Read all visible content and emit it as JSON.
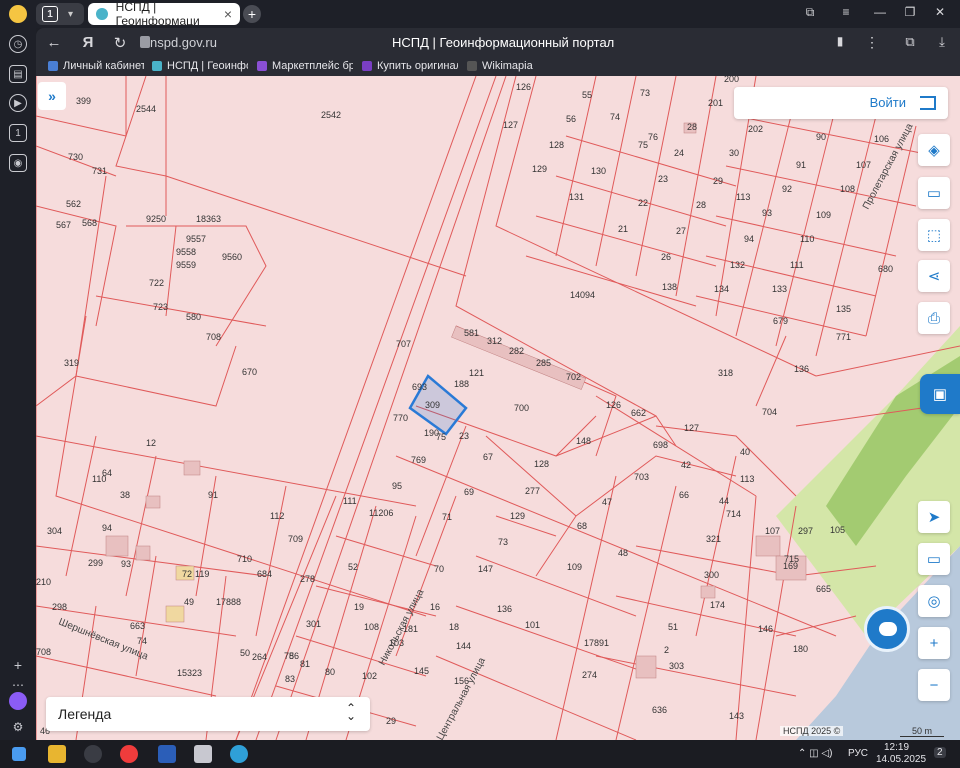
{
  "browser": {
    "tab_count": "1",
    "active_tab_title": "НСПД | Геоинформаци",
    "url_host": "nspd.gov.ru",
    "page_title": "НСПД | Геоинформационный портал",
    "bookmarks": [
      {
        "label": "Личный кабинет",
        "color": "#4a7fd4"
      },
      {
        "label": "НСПД | Геоинфор",
        "color": "#4ab3c9"
      },
      {
        "label": "Маркетплейс бре",
        "color": "#8a4fd4"
      },
      {
        "label": "Купить оригинал",
        "color": "#7a3fc4"
      },
      {
        "label": "Wikimapia",
        "color": "#555555"
      }
    ]
  },
  "map": {
    "login_label": "Войти",
    "legend_label": "Легенда",
    "copyright": "НСПД 2025 ©",
    "scale_label": "50 m",
    "streets": [
      "Пролетарская улица",
      "Никольская улица",
      "2-я Центральная улица",
      "Шершнёвская улица"
    ],
    "selected_plot": "126",
    "plot_labels": [
      "399",
      "2544",
      "2542",
      "126",
      "127",
      "55",
      "73",
      "200",
      "201",
      "28",
      "202",
      "90",
      "106",
      "730",
      "731",
      "128",
      "56",
      "74",
      "75",
      "76",
      "24",
      "30",
      "91",
      "107",
      "129",
      "130",
      "23",
      "29",
      "113",
      "92",
      "108",
      "562",
      "567",
      "568",
      "9250",
      "18363",
      "131",
      "22",
      "28",
      "93",
      "109",
      "9557",
      "9558",
      "9559",
      "9560",
      "21",
      "27",
      "94",
      "110",
      "26",
      "132",
      "111",
      "722",
      "14094",
      "138",
      "134",
      "133",
      "680",
      "723",
      "580",
      "135",
      "708",
      "581",
      "312",
      "282",
      "285",
      "679",
      "771",
      "707",
      "319",
      "670",
      "121",
      "702",
      "318",
      "136",
      "693",
      "188",
      "309",
      "126",
      "662",
      "700",
      "704",
      "770",
      "190",
      "75",
      "23",
      "127",
      "12",
      "148",
      "698",
      "40",
      "769",
      "67",
      "128",
      "703",
      "42",
      "64",
      "113",
      "110",
      "95",
      "69",
      "66",
      "38",
      "91",
      "111",
      "277",
      "129",
      "47",
      "44",
      "714",
      "107",
      "297",
      "304",
      "94",
      "112",
      "709",
      "11206",
      "71",
      "68",
      "321",
      "105",
      "299",
      "73",
      "48",
      "715",
      "93",
      "119",
      "710",
      "684",
      "278",
      "52",
      "70",
      "147",
      "109",
      "300",
      "169",
      "210",
      "72",
      "49",
      "17888",
      "298",
      "301",
      "19",
      "16",
      "136",
      "174",
      "665",
      "663",
      "74",
      "50",
      "108",
      "181",
      "18",
      "101",
      "51",
      "146",
      "708",
      "264",
      "56",
      "81",
      "78",
      "103",
      "144",
      "17891",
      "2",
      "303",
      "180",
      "15323",
      "83",
      "80",
      "102",
      "145",
      "156",
      "274",
      "636",
      "143",
      "46",
      "29"
    ],
    "colors": {
      "parcel_fill": "#f6dcdc",
      "parcel_stroke": "#e05a5a",
      "selected_stroke": "#2a7ad6",
      "forest": "#d4e6a8",
      "water": "#b8c9dc",
      "accent": "#1f7ac9"
    }
  },
  "taskbar": {
    "lang": "РУС",
    "time": "12:19",
    "date": "14.05.2025",
    "notifications": "2"
  }
}
